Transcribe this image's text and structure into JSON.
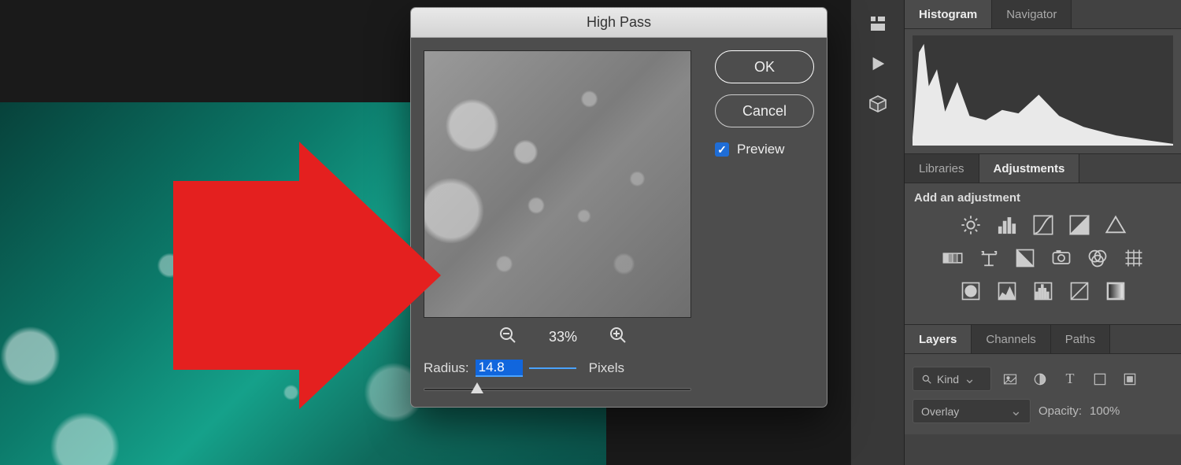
{
  "dialog": {
    "title": "High Pass",
    "ok_label": "OK",
    "cancel_label": "Cancel",
    "preview_label": "Preview",
    "preview_checked": true,
    "zoom_level": "33%",
    "radius_label": "Radius:",
    "radius_value": "14.8",
    "radius_unit": "Pixels"
  },
  "panels": {
    "top_tabs": {
      "histogram": "Histogram",
      "navigator": "Navigator"
    },
    "mid_tabs": {
      "libraries": "Libraries",
      "adjustments": "Adjustments"
    },
    "adjustments_heading": "Add an adjustment",
    "layers_tabs": {
      "layers": "Layers",
      "channels": "Channels",
      "paths": "Paths"
    },
    "filter_label": "Kind",
    "blend_mode": "Overlay",
    "opacity_label": "Opacity:",
    "opacity_value": "100%"
  },
  "icons": {
    "search": "search-icon"
  }
}
